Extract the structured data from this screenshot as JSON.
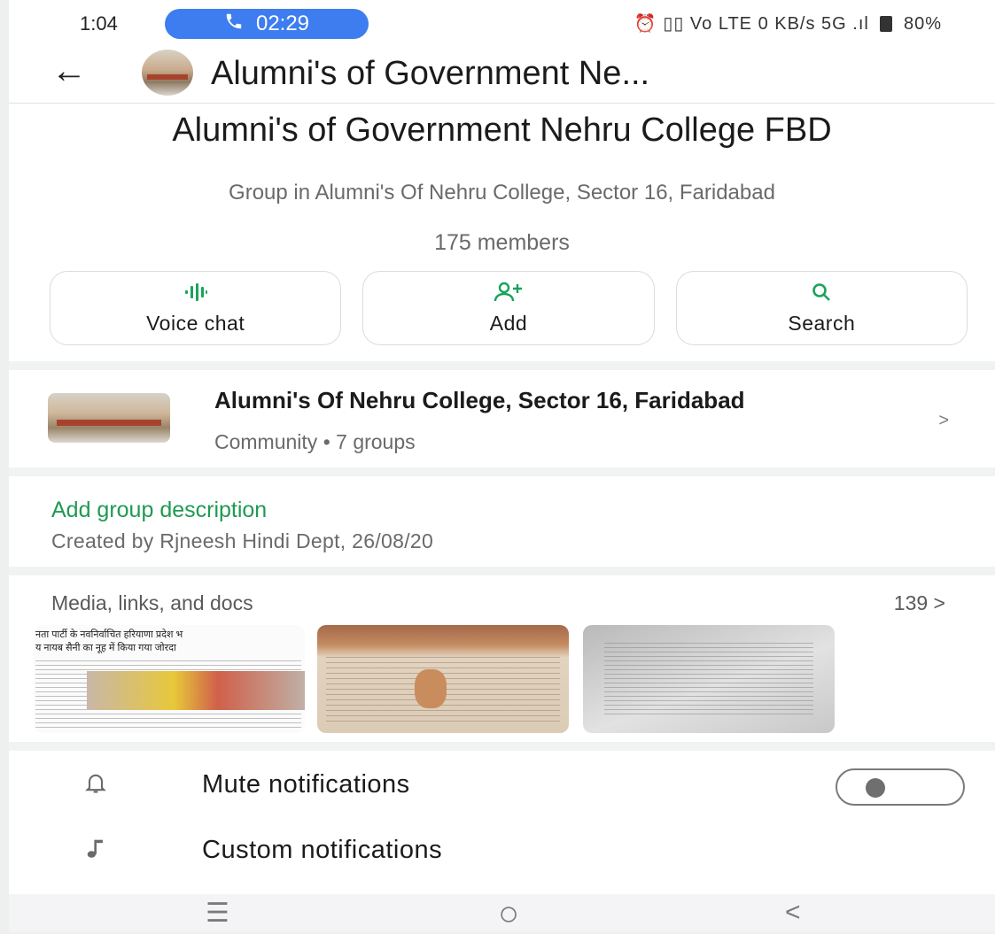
{
  "status_bar": {
    "time": "1:04",
    "call_timer": "02:29",
    "indicators": "⏰ ▯▯ Vo LTE 0 KB/s 5G .ıl",
    "battery": "80%"
  },
  "header": {
    "title": "Alumni's of Government Ne...",
    "avatar_icon": "group-avatar"
  },
  "group": {
    "name": "Alumni's of Government Nehru College FBD",
    "subtitle": "Group in Alumni's Of Nehru College, Sector 16, Faridabad",
    "members": "175 members"
  },
  "actions": [
    {
      "label": "Voice chat",
      "icon": "voice-chat-icon"
    },
    {
      "label": "Add",
      "icon": "add-person-icon"
    },
    {
      "label": "Search",
      "icon": "search-icon"
    }
  ],
  "community": {
    "title": "Alumni's Of Nehru College, Sector 16, Faridabad",
    "meta": "Community • 7 groups",
    "chevron": ">"
  },
  "description": {
    "add_link": "Add group description",
    "created": "Created by Rjneesh Hindi Dept, 26/08/20"
  },
  "media": {
    "title": "Media, links, and docs",
    "count": "139  >",
    "thumb1_headline": "नता पार्टी के नवनिर्वाचित हरियाणा प्रदेश भ",
    "thumb1_headline2": "य नायब सैनी  का नूह में किया गया जोरदा"
  },
  "settings": {
    "mute": {
      "label": "Mute notifications",
      "enabled": false
    },
    "custom": {
      "label": "Custom notifications"
    }
  },
  "navbar": {
    "recents": "☰",
    "home": "○",
    "back": "<"
  },
  "colors": {
    "accent_green": "#1f9a52",
    "call_pill": "#3d7df0"
  }
}
